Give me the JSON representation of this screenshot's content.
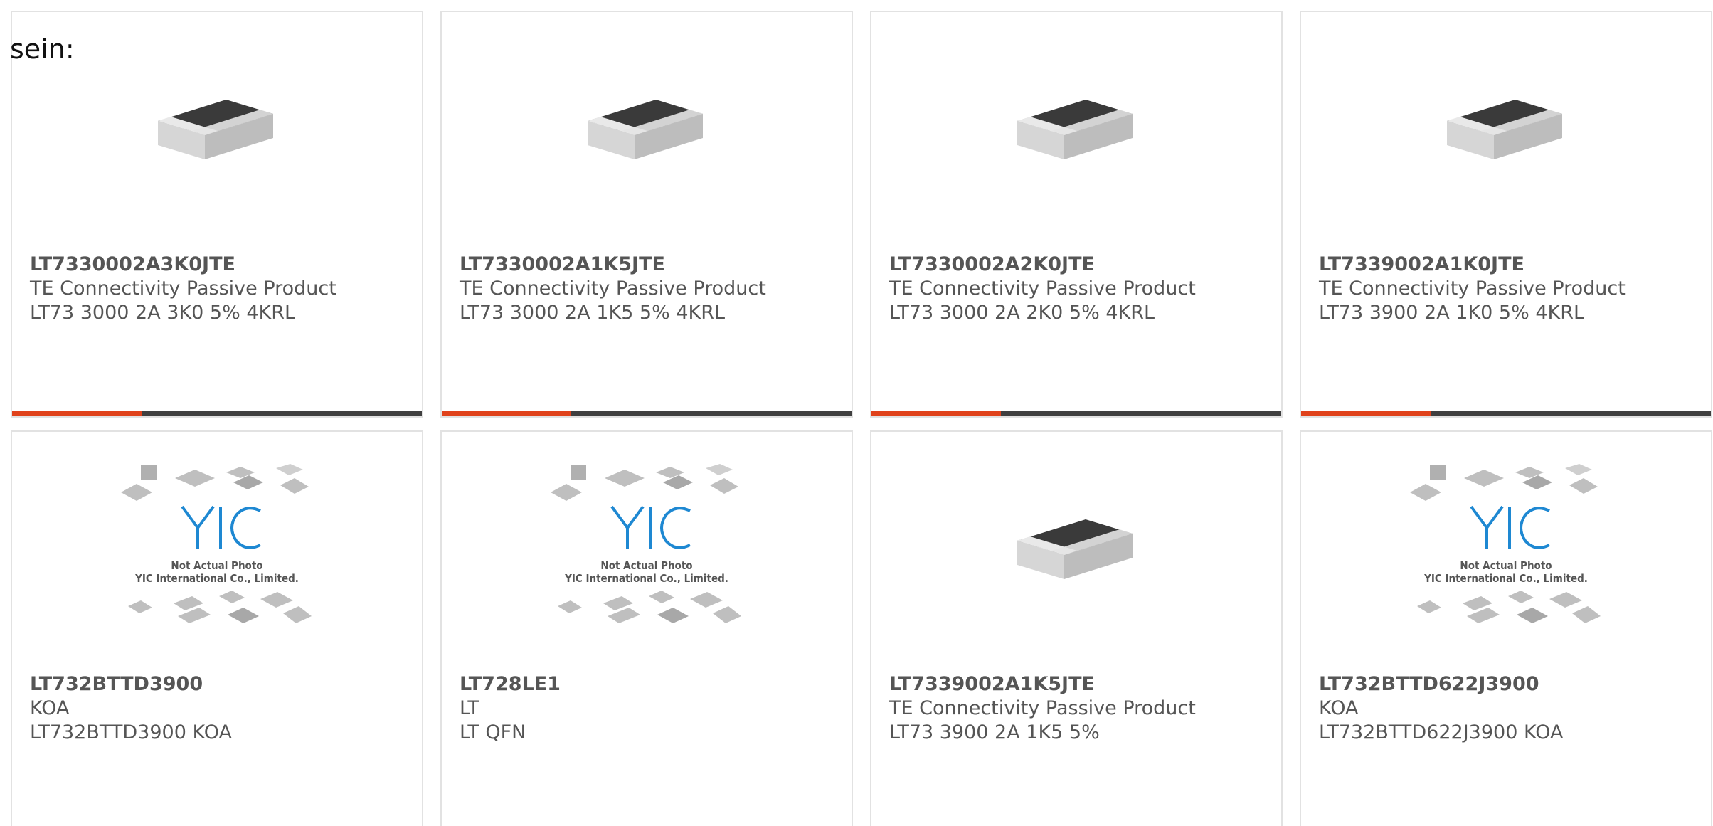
{
  "intro_text": "sein:",
  "colors": {
    "accent_bar": "#e0421b",
    "dark_bar": "#3f3f3f",
    "text": "#555555",
    "logo_blue": "#1e88d2"
  },
  "products": [
    {
      "part_number": "LT7330002A3K0JTE",
      "manufacturer": "TE Connectivity Passive Product",
      "description": "LT73 3000 2A 3K0 5% 4KRL",
      "image": "chip-resistor"
    },
    {
      "part_number": "LT7330002A1K5JTE",
      "manufacturer": "TE Connectivity Passive Product",
      "description": "LT73 3000 2A 1K5 5% 4KRL",
      "image": "chip-resistor"
    },
    {
      "part_number": "LT7330002A2K0JTE",
      "manufacturer": "TE Connectivity Passive Product",
      "description": "LT73 3000 2A 2K0 5% 4KRL",
      "image": "chip-resistor"
    },
    {
      "part_number": "LT7339002A1K0JTE",
      "manufacturer": "TE Connectivity Passive Product",
      "description": "LT73 3900 2A 1K0 5% 4KRL",
      "image": "chip-resistor"
    },
    {
      "part_number": "LT732BTTD3900",
      "manufacturer": "KOA",
      "description": "LT732BTTD3900 KOA",
      "image": "placeholder",
      "placeholder_line1": "Not Actual Photo",
      "placeholder_line2": "YIC International Co., Limited."
    },
    {
      "part_number": "LT728LE1",
      "manufacturer": "LT",
      "description": "LT QFN",
      "image": "placeholder",
      "placeholder_line1": "Not Actual Photo",
      "placeholder_line2": "YIC International Co., Limited."
    },
    {
      "part_number": "LT7339002A1K5JTE",
      "manufacturer": "TE Connectivity Passive Product",
      "description": "LT73 3900 2A 1K5 5%",
      "image": "chip-resistor"
    },
    {
      "part_number": "LT732BTTD622J3900",
      "manufacturer": "KOA",
      "description": "LT732BTTD622J3900 KOA",
      "image": "placeholder",
      "placeholder_line1": "Not Actual Photo",
      "placeholder_line2": "YIC International Co., Limited."
    }
  ]
}
